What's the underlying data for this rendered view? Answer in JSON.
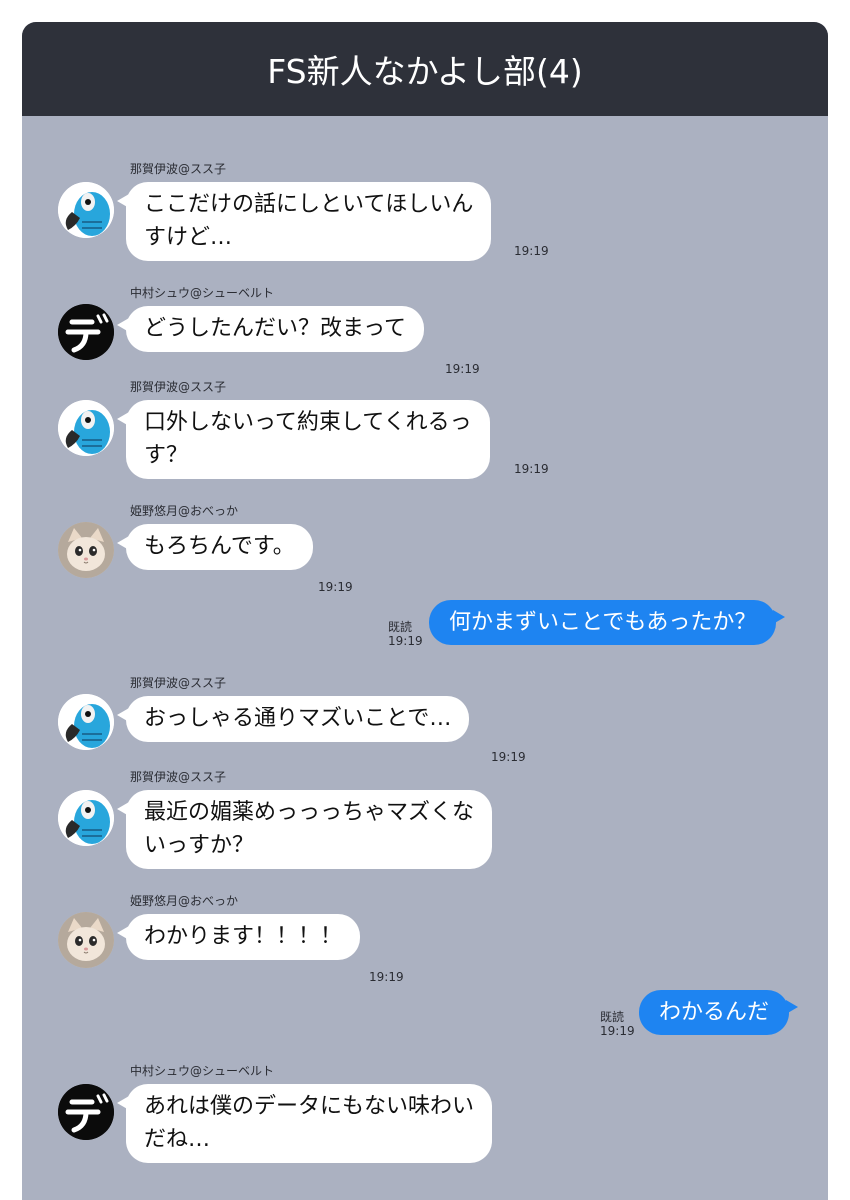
{
  "header": {
    "title": "FS新人なかよし部(4)"
  },
  "colors": {
    "header_bg": "#2e313a",
    "chat_bg": "#abb1c1",
    "outgoing_bubble": "#1e84f1",
    "incoming_bubble": "#ffffff"
  },
  "messages": [
    {
      "type": "in",
      "sender": "那賀伊波@スス子",
      "avatar": "parrot-avatar",
      "lines": [
        "ここだけの話にしといてほしいん",
        "すけど…"
      ],
      "time": "19:19"
    },
    {
      "type": "in",
      "sender": "中村シュウ@シューベルト",
      "avatar": "de-logo-avatar",
      "lines": [
        "どうしたんだい？改まって"
      ],
      "time": "19:19"
    },
    {
      "type": "in",
      "sender": "那賀伊波@スス子",
      "avatar": "parrot-avatar",
      "lines": [
        "口外しないって約束してくれるっ",
        "す？"
      ],
      "time": "19:19"
    },
    {
      "type": "in",
      "sender": "姫野悠月@おべっか",
      "avatar": "cat-avatar",
      "lines": [
        "もろちんです。"
      ],
      "time": "19:19"
    },
    {
      "type": "out",
      "read": "既読",
      "time": "19:19",
      "lines": [
        "何かまずいことでもあったか？"
      ]
    },
    {
      "type": "in",
      "sender": "那賀伊波@スス子",
      "avatar": "parrot-avatar",
      "lines": [
        "おっしゃる通りマズいことで…"
      ],
      "time": "19:19"
    },
    {
      "type": "in",
      "sender": "那賀伊波@スス子",
      "avatar": "parrot-avatar",
      "lines": [
        "最近の媚薬めっっっちゃマズくな",
        "いっすか？"
      ],
      "time": ""
    },
    {
      "type": "in",
      "sender": "姫野悠月@おべっか",
      "avatar": "cat-avatar",
      "lines": [
        "わかります！！！！"
      ],
      "time": "19:19"
    },
    {
      "type": "out",
      "read": "既読",
      "time": "19:19",
      "lines": [
        "わかるんだ"
      ]
    },
    {
      "type": "in",
      "sender": "中村シュウ@シューベルト",
      "avatar": "de-logo-avatar",
      "lines": [
        "あれは僕のデータにもない味わい",
        "だね…"
      ],
      "time": ""
    }
  ]
}
